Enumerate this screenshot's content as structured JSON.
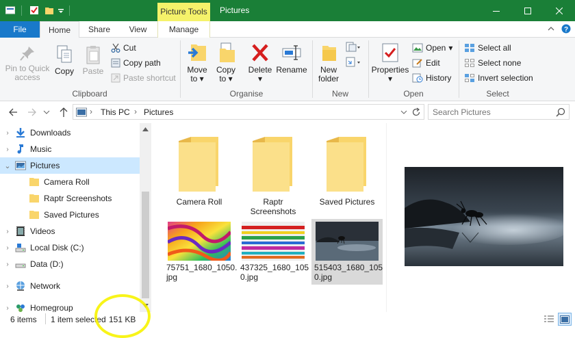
{
  "titlebar": {
    "context_tab": "Picture Tools",
    "title": "Pictures",
    "minimize_icon": "minimize-icon",
    "maximize_icon": "maximize-icon",
    "close_icon": "close-icon"
  },
  "tabs": {
    "file": "File",
    "home": "Home",
    "share": "Share",
    "view": "View",
    "manage": "Manage"
  },
  "ribbon": {
    "clipboard": {
      "label": "Clipboard",
      "pin_line1": "Pin to Quick",
      "pin_line2": "access",
      "copy": "Copy",
      "paste": "Paste",
      "cut": "Cut",
      "copy_path": "Copy path",
      "paste_shortcut": "Paste shortcut"
    },
    "organise": {
      "label": "Organise",
      "move_line1": "Move",
      "move_line2": "to",
      "copy_line1": "Copy",
      "copy_line2": "to",
      "delete": "Delete",
      "rename": "Rename"
    },
    "new": {
      "label": "New",
      "folder_line1": "New",
      "folder_line2": "folder"
    },
    "open": {
      "label": "Open",
      "properties": "Properties",
      "open": "Open",
      "edit": "Edit",
      "history": "History"
    },
    "select": {
      "label": "Select",
      "all": "Select all",
      "none": "Select none",
      "invert": "Invert selection"
    }
  },
  "address": {
    "crumbs": [
      "This PC",
      "Pictures"
    ],
    "search_placeholder": "Search Pictures"
  },
  "nav": {
    "items": [
      {
        "label": "Downloads"
      },
      {
        "label": "Music"
      },
      {
        "label": "Pictures"
      },
      {
        "label": "Camera Roll"
      },
      {
        "label": "Raptr Screenshots"
      },
      {
        "label": "Saved Pictures"
      },
      {
        "label": "Videos"
      },
      {
        "label": "Local Disk (C:)"
      },
      {
        "label": "Data (D:)"
      },
      {
        "label": "Network"
      },
      {
        "label": "Homegroup"
      }
    ]
  },
  "files": {
    "folders": [
      {
        "line1": "Camera Roll",
        "line2": ""
      },
      {
        "line1": "Raptr",
        "line2": "Screenshots"
      },
      {
        "line1": "Saved Pictures",
        "line2": ""
      }
    ],
    "images": [
      {
        "line1": "75751_1680_1050.",
        "line2": "jpg"
      },
      {
        "line1": "437325_1680_105",
        "line2": "0.jpg"
      },
      {
        "line1": "515403_1680_105",
        "line2": "0.jpg"
      }
    ]
  },
  "status": {
    "items": "6 items",
    "selected": "1 item selected",
    "size": "151 KB"
  },
  "colors": {
    "titlebar": "#1a7f37",
    "context_tab": "#f5f26a",
    "file_tab": "#1979ca",
    "selection": "#cce8ff",
    "highlight": "#f7f300"
  }
}
